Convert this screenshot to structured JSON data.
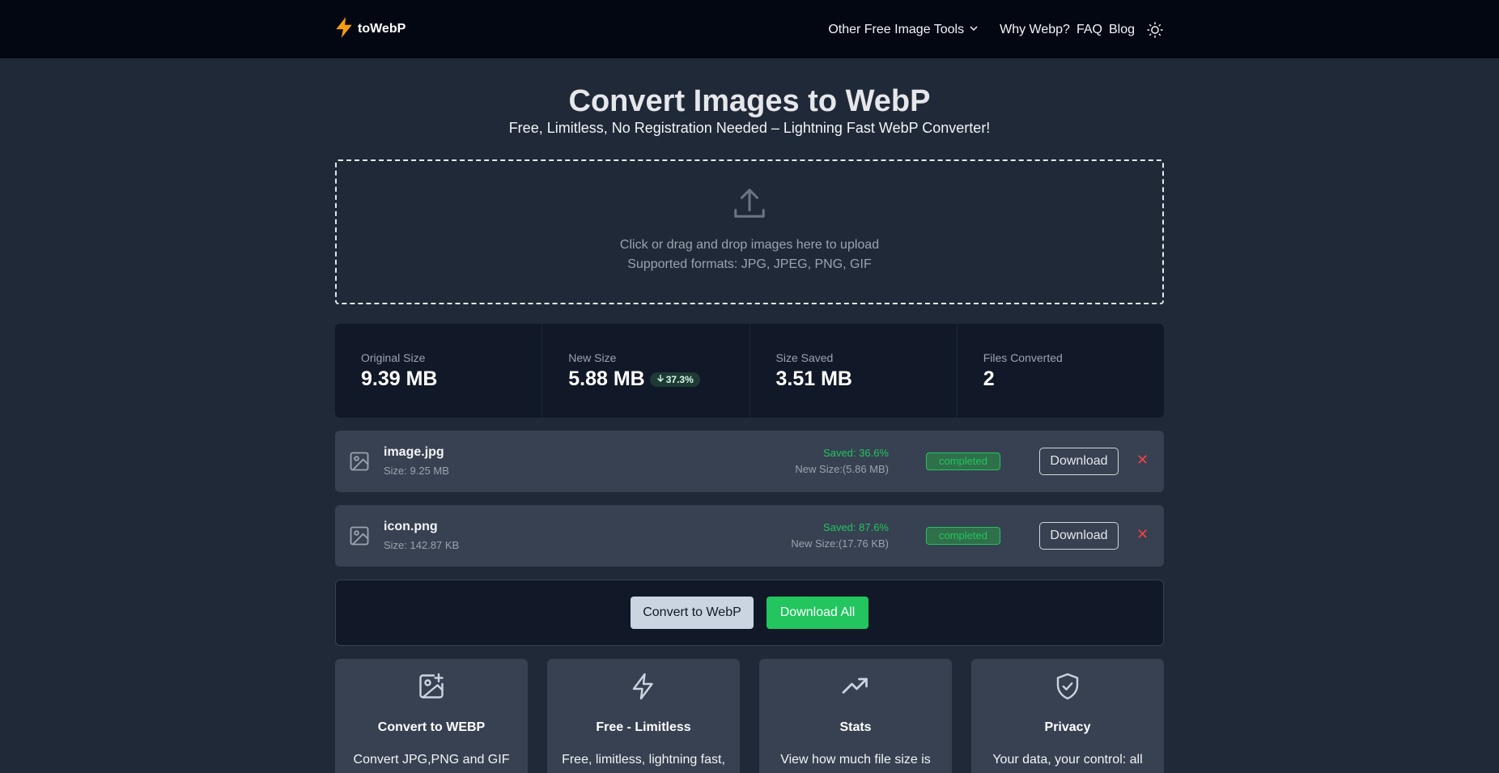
{
  "header": {
    "logo_text": "toWebP",
    "nav": {
      "tools_label": "Other Free Image Tools",
      "why_label": "Why Webp?",
      "faq_label": "FAQ",
      "blog_label": "Blog"
    },
    "icons": {
      "logo": "lightning-icon",
      "theme": "sun-icon",
      "dropdown": "chevron-down-icon"
    }
  },
  "hero": {
    "title": "Convert Images to WebP",
    "subtitle": "Free, Limitless, No Registration Needed – Lightning Fast WebP Converter!"
  },
  "dropzone": {
    "line1": "Click or drag and drop images here to upload",
    "line2": "Supported formats: JPG, JPEG, PNG, GIF",
    "icon": "upload-icon"
  },
  "stats": {
    "original": {
      "label": "Original Size",
      "value": "9.39 MB"
    },
    "new": {
      "label": "New Size",
      "value": "5.88 MB",
      "badge": "37.3%"
    },
    "saved": {
      "label": "Size Saved",
      "value": "3.51 MB"
    },
    "files": {
      "label": "Files Converted",
      "value": "2"
    }
  },
  "files": [
    {
      "name": "image.jpg",
      "size": "Size: 9.25 MB",
      "saved": "Saved: 36.6%",
      "new_size": "New Size:(5.86 MB)",
      "status": "completed",
      "download_label": "Download",
      "remove_label": "✕"
    },
    {
      "name": "icon.png",
      "size": "Size: 142.87 KB",
      "saved": "Saved: 87.6%",
      "new_size": "New Size:(17.76 KB)",
      "status": "completed",
      "download_label": "Download",
      "remove_label": "✕"
    }
  ],
  "actions": {
    "convert_label": "Convert to WebP",
    "download_all_label": "Download All"
  },
  "features": [
    {
      "title": "Convert to WEBP",
      "desc": "Convert JPG,PNG and GIF",
      "icon": "image-plus-icon"
    },
    {
      "title": "Free - Limitless",
      "desc": "Free, limitless, lightning fast,",
      "icon": "lightning-icon"
    },
    {
      "title": "Stats",
      "desc": "View how much file size is",
      "icon": "trending-up-icon"
    },
    {
      "title": "Privacy",
      "desc": "Your data, your control: all",
      "icon": "shield-check-icon"
    }
  ],
  "colors": {
    "page_bg": "#1f2937",
    "header_bg": "#030712",
    "accent_green": "#22c55e",
    "logo_bolt": "#f59e0b",
    "danger": "#ef4444"
  }
}
